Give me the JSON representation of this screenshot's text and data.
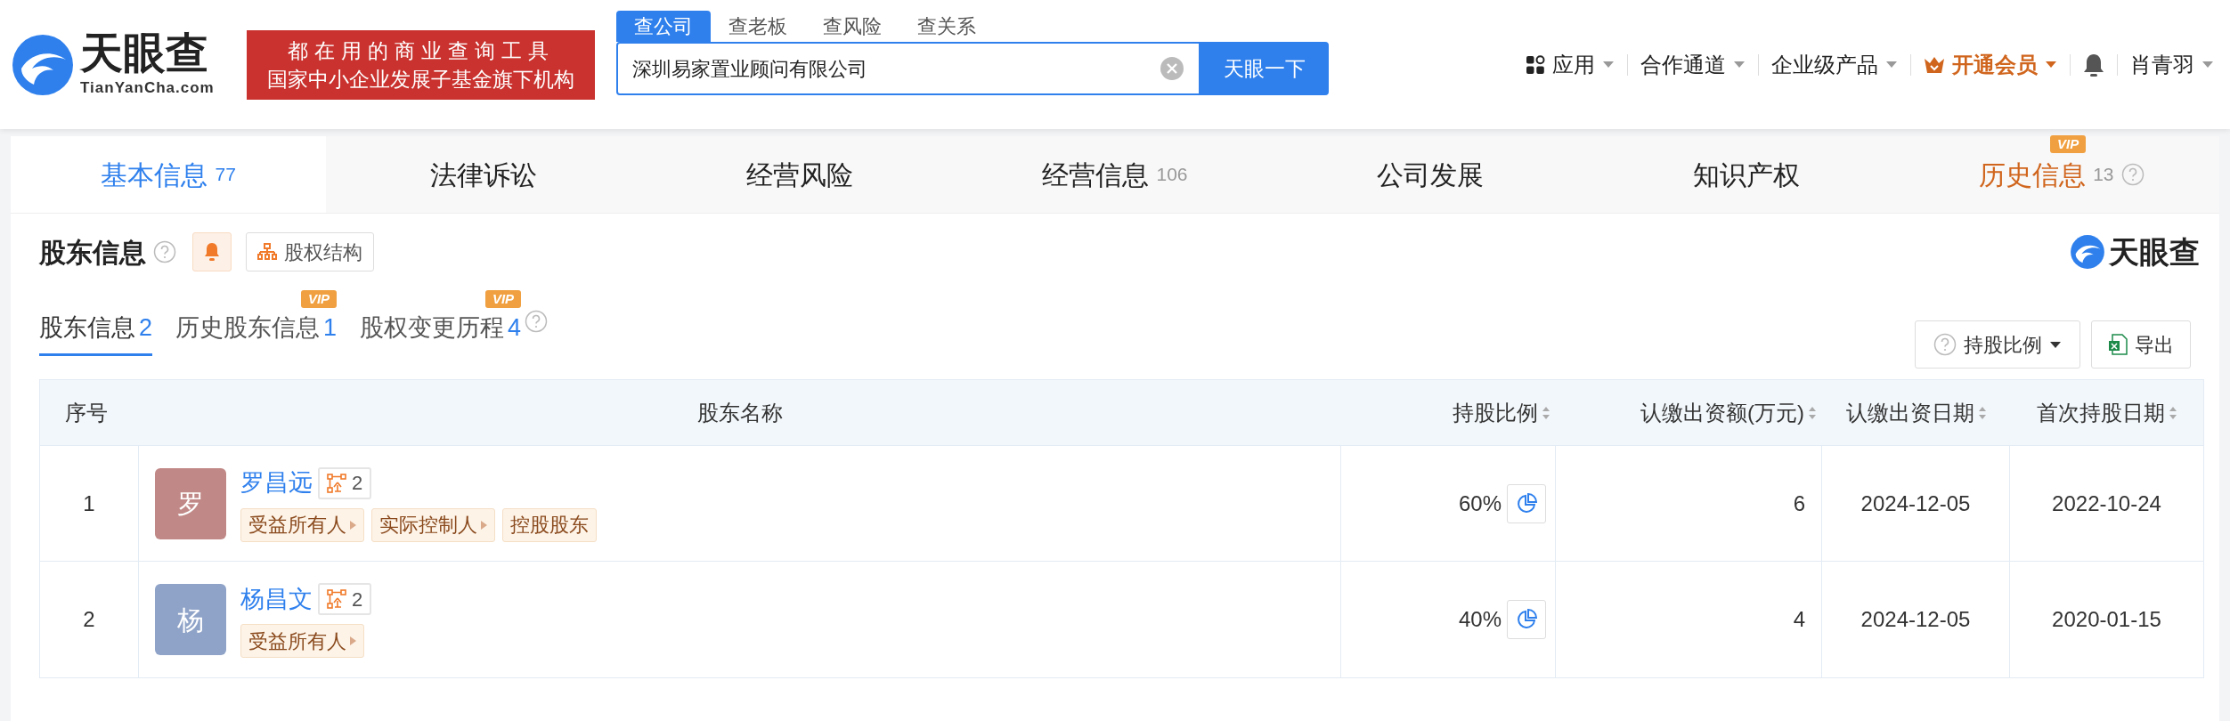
{
  "logo": {
    "name": "天眼查",
    "domain": "TianYanCha.com"
  },
  "banner": [
    "都在用的商业查询工具",
    "国家中小企业发展子基金旗下机构"
  ],
  "search": {
    "tabs": [
      {
        "label": "查公司",
        "selected": true
      },
      {
        "label": "查老板",
        "selected": false
      },
      {
        "label": "查风险",
        "selected": false
      },
      {
        "label": "查关系",
        "selected": false
      }
    ],
    "value": "深圳易家置业顾问有限公司",
    "button": "天眼一下"
  },
  "nav": [
    {
      "kind": "apps",
      "label": "应用"
    },
    {
      "kind": "plain",
      "label": "合作通道"
    },
    {
      "kind": "plain",
      "label": "企业级产品"
    },
    {
      "kind": "vip",
      "label": "开通会员"
    },
    {
      "kind": "bell"
    },
    {
      "kind": "plain",
      "label": "肖青羽"
    }
  ],
  "main_tabs": [
    {
      "label": "基本信息",
      "count": "77",
      "selected": true,
      "kind": "normal"
    },
    {
      "label": "法律诉讼",
      "selected": false,
      "kind": "normal"
    },
    {
      "label": "经营风险",
      "selected": false,
      "kind": "normal"
    },
    {
      "label": "经营信息",
      "count": "106",
      "selected": false,
      "kind": "normal"
    },
    {
      "label": "公司发展",
      "selected": false,
      "kind": "normal"
    },
    {
      "label": "知识产权",
      "selected": false,
      "kind": "normal"
    },
    {
      "label": "历史信息",
      "count": "13",
      "selected": false,
      "kind": "vip",
      "badge": "VIP",
      "help": true
    }
  ],
  "section": {
    "title": "股东信息",
    "structure_button": "股权结构",
    "brand": "天眼查",
    "sub_tabs": [
      {
        "label": "股东信息",
        "count": "2",
        "selected": true
      },
      {
        "label": "历史股东信息",
        "count": "1",
        "selected": false,
        "badge": "VIP"
      },
      {
        "label": "股权变更历程",
        "count": "4",
        "selected": false,
        "badge": "VIP",
        "help": true
      }
    ],
    "ratio_button": "持股比例",
    "export_button": "导出"
  },
  "table": {
    "columns": [
      {
        "label": "序号",
        "sortable": false
      },
      {
        "label": "股东名称",
        "sortable": false
      },
      {
        "label": "持股比例",
        "sortable": true
      },
      {
        "label": "认缴出资额(万元)",
        "sortable": true
      },
      {
        "label": "认缴出资日期",
        "sortable": true
      },
      {
        "label": "首次持股日期",
        "sortable": true
      }
    ],
    "rows": [
      {
        "index": "1",
        "avatar": "罗",
        "color": "#c08886",
        "name": "罗昌远",
        "company_count": "2",
        "tags": [
          {
            "label": "受益所有人",
            "arrow": true
          },
          {
            "label": "实际控制人",
            "arrow": true
          },
          {
            "label": "控股股东",
            "arrow": false
          }
        ],
        "ratio": "60%",
        "amount": "6",
        "date": "2024-12-05",
        "first_date": "2022-10-24"
      },
      {
        "index": "2",
        "avatar": "杨",
        "color": "#8fa3c8",
        "name": "杨昌文",
        "company_count": "2",
        "tags": [
          {
            "label": "受益所有人",
            "arrow": true
          }
        ],
        "ratio": "40%",
        "amount": "4",
        "date": "2024-12-05",
        "first_date": "2020-01-15"
      }
    ]
  }
}
